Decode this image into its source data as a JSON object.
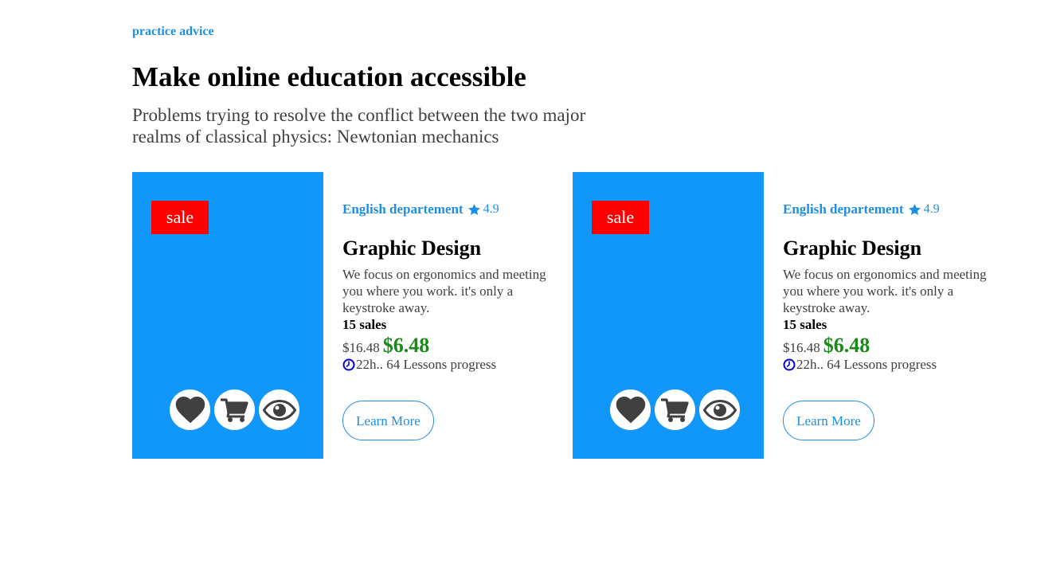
{
  "header": {
    "eyebrow": "practice advice",
    "title": "Make online education accessible",
    "subtitle": "Problems trying to resolve the conflict between the two major realms of classical physics: Newtonian mechanics"
  },
  "colors": {
    "accent": "#1e8fe0",
    "thumb_bg": "#1196fa",
    "sale_badge": "#ff0000",
    "new_price": "#1a8a1a"
  },
  "cards": [
    {
      "badge": "sale",
      "department": "English departement",
      "rating": "4.9",
      "title": "Graphic Design",
      "description": "We focus on ergonomics and meeting you where you work. it's only a keystroke away.",
      "sales": "15 sales",
      "old_price": "$16.48",
      "new_price": "$6.48",
      "progress": "22h.. 64 Lessons progress",
      "cta": "Learn More",
      "action_icons": [
        "heart-icon",
        "cart-icon",
        "eye-icon"
      ]
    },
    {
      "badge": "sale",
      "department": "English departement",
      "rating": "4.9",
      "title": "Graphic Design",
      "description": "We focus on ergonomics and meeting you where you work. it's only a keystroke away.",
      "sales": "15 sales",
      "old_price": "$16.48",
      "new_price": "$6.48",
      "progress": "22h.. 64 Lessons progress",
      "cta": "Learn More",
      "action_icons": [
        "heart-icon",
        "cart-icon",
        "eye-icon"
      ]
    }
  ]
}
